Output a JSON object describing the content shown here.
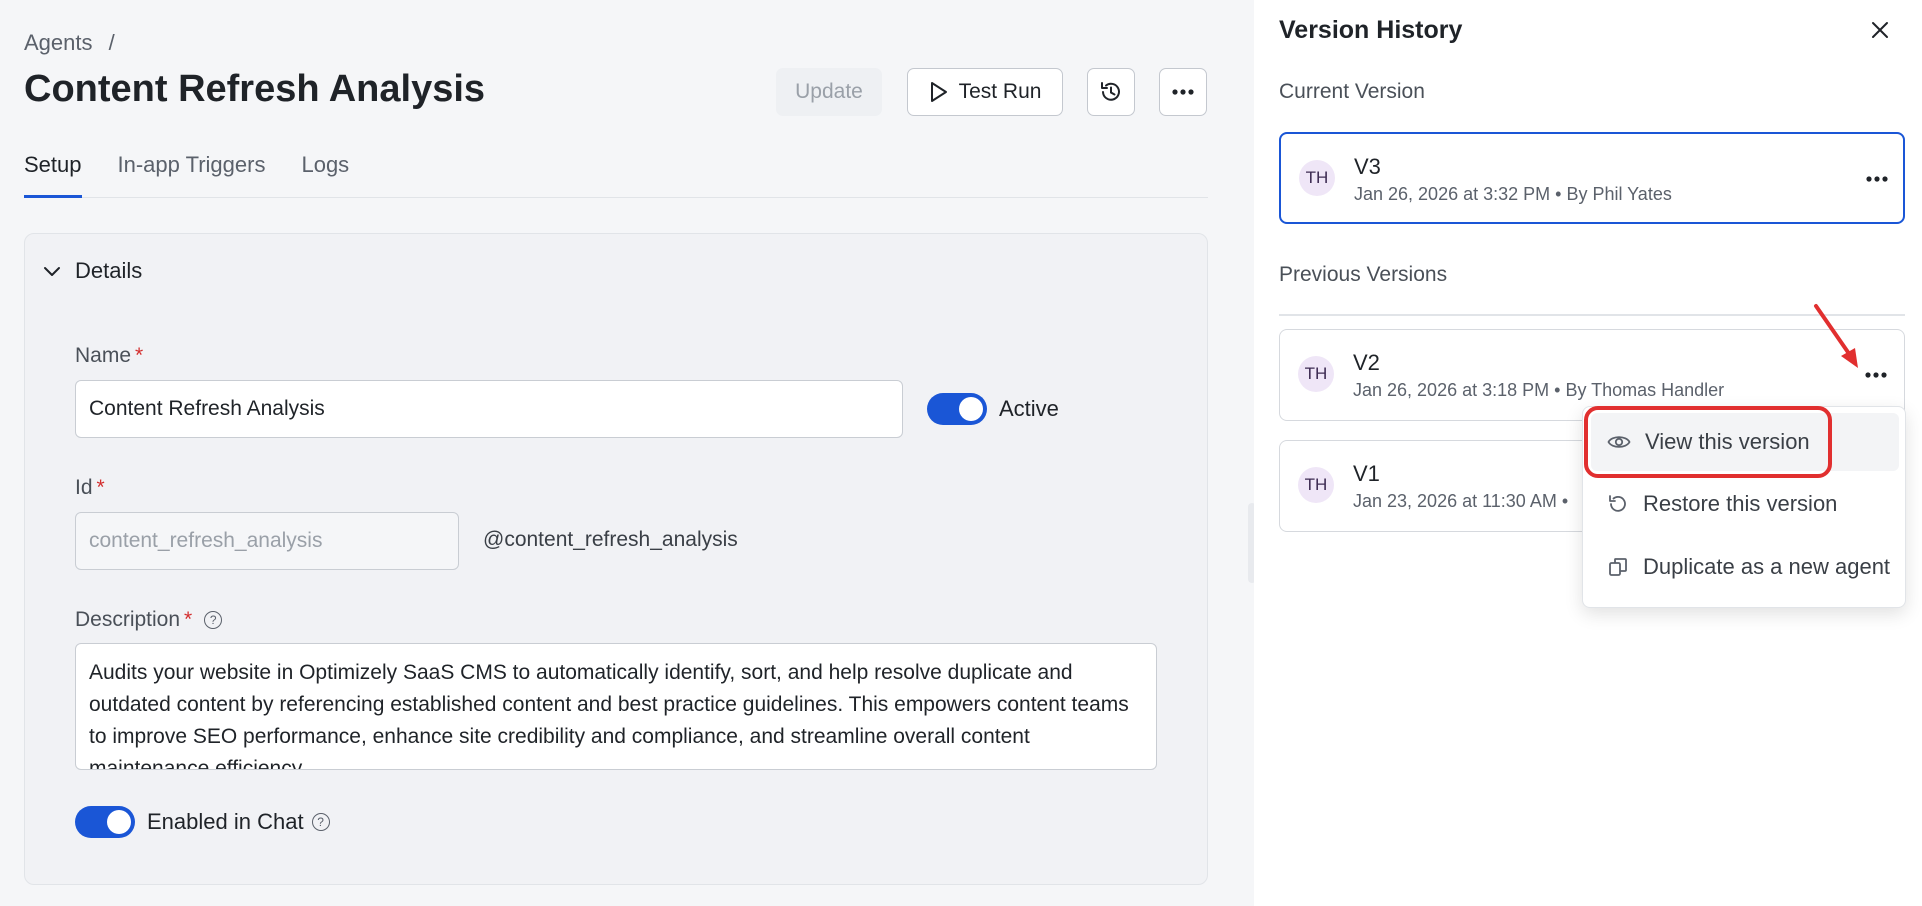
{
  "breadcrumb": {
    "root": "Agents",
    "separator": "/"
  },
  "page_title": "Content Refresh Analysis",
  "header_actions": {
    "update_label": "Update",
    "test_run_label": "Test Run",
    "history_icon": "history-icon",
    "more_icon": "more-horizontal-icon"
  },
  "tabs": [
    {
      "label": "Setup",
      "active": true
    },
    {
      "label": "In-app Triggers",
      "active": false
    },
    {
      "label": "Logs",
      "active": false
    }
  ],
  "details": {
    "section_label": "Details",
    "name_label": "Name",
    "name_value": "Content Refresh Analysis",
    "active_label": "Active",
    "active_on": true,
    "id_label": "Id",
    "id_value": "content_refresh_analysis",
    "id_handle": "@content_refresh_analysis",
    "description_label": "Description",
    "description_value": "Audits your website in Optimizely SaaS CMS to automatically identify, sort, and help resolve duplicate and outdated content by referencing established content and best practice guidelines. This empowers content teams to improve SEO performance, enhance site credibility and compliance, and streamline overall content maintenance efficiency.",
    "enabled_in_chat_label": "Enabled in Chat",
    "enabled_in_chat_on": true,
    "required_mark": "*"
  },
  "version_history": {
    "title": "Version History",
    "current_label": "Current Version",
    "previous_label": "Previous Versions",
    "current": {
      "avatar": "TH",
      "version": "V3",
      "meta": "Jan 26, 2026 at 3:32 PM • By Phil Yates"
    },
    "previous": [
      {
        "avatar": "TH",
        "version": "V2",
        "meta": "Jan 26, 2026 at 3:18 PM • By Thomas Handler"
      },
      {
        "avatar": "TH",
        "version": "V1",
        "meta": "Jan 23, 2026 at 11:30 AM •"
      }
    ]
  },
  "context_menu": {
    "items": [
      {
        "label": "View this version",
        "icon": "eye-icon"
      },
      {
        "label": "Restore this version",
        "icon": "restore-icon"
      },
      {
        "label": "Duplicate as a new agent",
        "icon": "duplicate-icon"
      }
    ]
  },
  "colors": {
    "accent": "#1a56d6",
    "required": "#d32f2f",
    "annotation_red": "#e12f2f"
  }
}
